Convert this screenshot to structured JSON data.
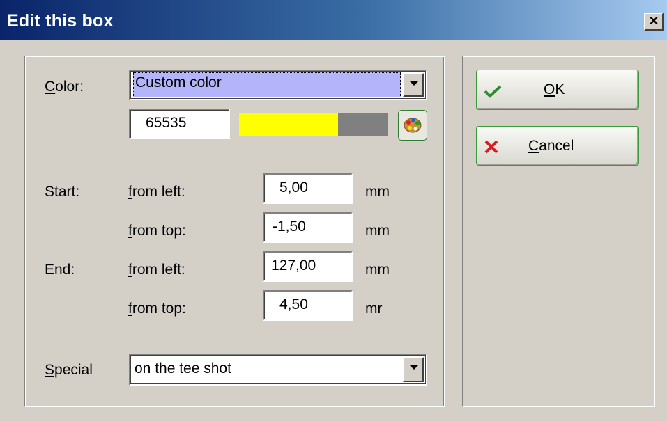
{
  "window": {
    "title": "Edit this box",
    "close_symbol": "×"
  },
  "color": {
    "label": "Color:",
    "label_mnemonic": "C",
    "label_rest": "olor:",
    "selected_option": "Custom color",
    "value": "65535",
    "swatch_colors": [
      "#ffff00",
      "#808080"
    ]
  },
  "start": {
    "label": "Start:",
    "from_left": {
      "label_mnemonic": "f",
      "label_rest": "rom left:",
      "value": "5,00",
      "unit": "mm"
    },
    "from_top": {
      "label_mnemonic": "f",
      "label_rest": "rom top:",
      "value": "-1,50",
      "unit": "mm"
    }
  },
  "end": {
    "label": "End:",
    "from_left": {
      "label_mnemonic": "f",
      "label_rest": "rom left:",
      "value": "127,00",
      "unit": "mm"
    },
    "from_top": {
      "label_mnemonic": "f",
      "label_rest": "rom top:",
      "value": "4,50",
      "unit": "mr"
    }
  },
  "special": {
    "label_mnemonic": "S",
    "label_rest": "pecial",
    "selected_option": "on the tee shot"
  },
  "buttons": {
    "ok": {
      "mnemonic": "O",
      "rest": "K",
      "icon": "checkmark-icon",
      "icon_color": "#2e8b2e"
    },
    "cancel": {
      "mnemonic": "C",
      "rest": "ancel",
      "icon": "red-x-icon",
      "icon_color": "#d42020"
    }
  }
}
